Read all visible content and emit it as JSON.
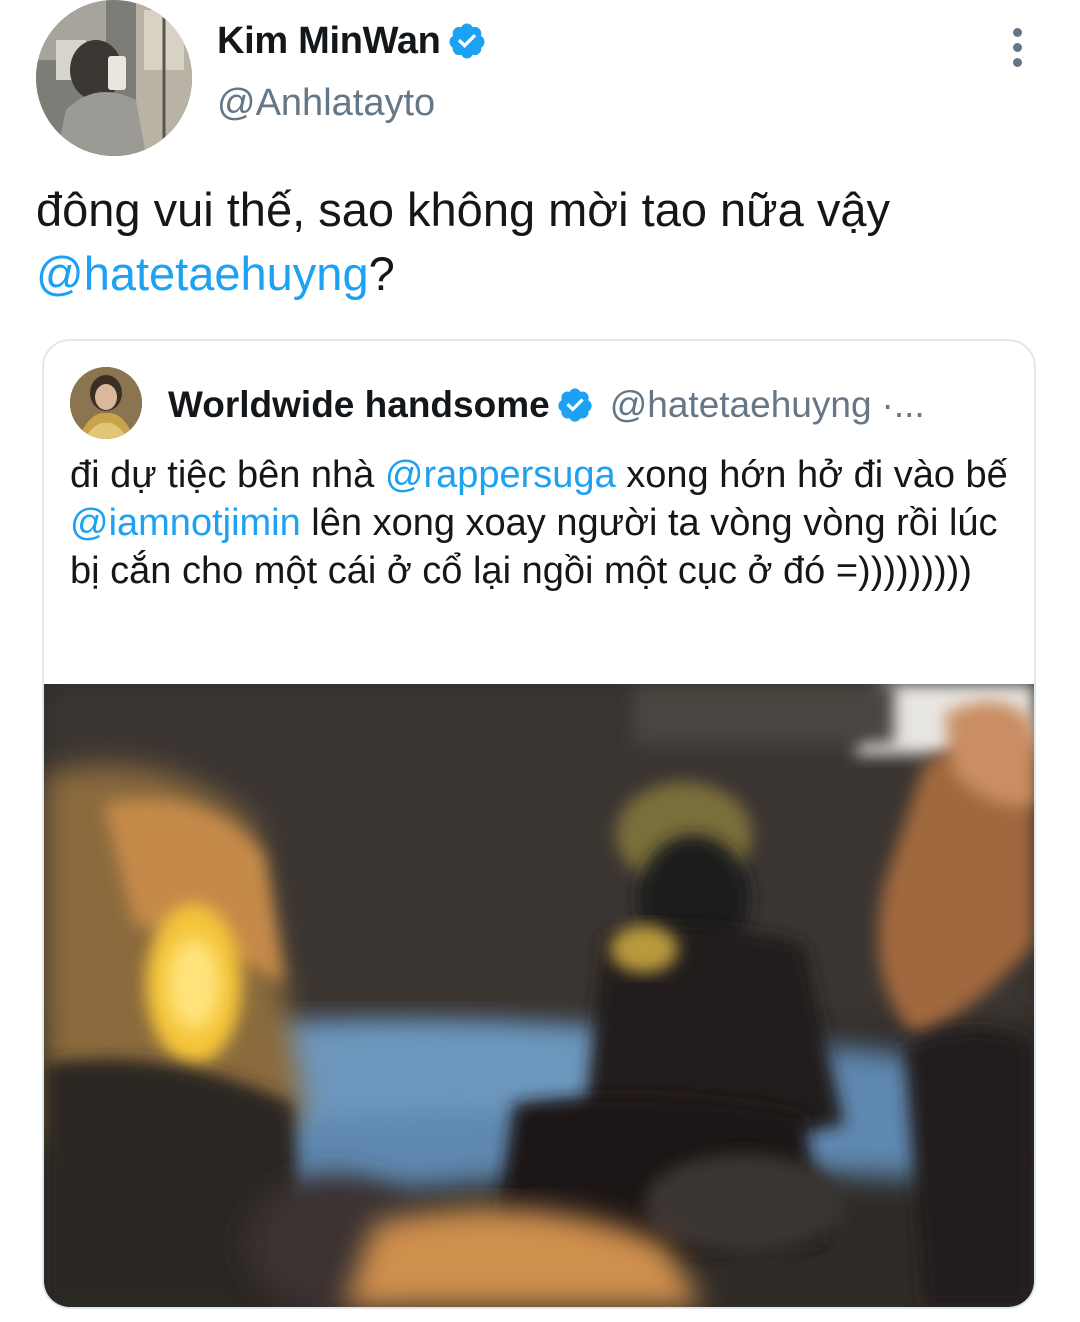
{
  "tweet": {
    "author": {
      "display_name": "Kim MinWan",
      "handle": "@Anhlatayto",
      "verified": true,
      "avatar_icon": "profile-photo"
    },
    "text_parts": {
      "line1": "đông vui thế, sao không mời tao nữa vậy",
      "mention": "@hatetaehuyng",
      "tail": "?"
    },
    "more_icon": "more-vertical-icon"
  },
  "quoted_tweet": {
    "author": {
      "display_name": "Worldwide handsome",
      "handle": "@hatetaehuyng",
      "separator": "·",
      "time_truncated": "...",
      "verified": true
    },
    "text_parts": {
      "p1": "đi dự tiệc bên nhà ",
      "m1": "@rappersuga",
      "p2": " xong hớn hở đi vào bế ",
      "m2": "@iamnotjimin",
      "p3": " lên xong xoay người ta vòng vòng rồi lúc bị cắn cho một cái ở cổ lại ngồi một cục ở đó =)))))))))"
    },
    "media": {
      "type": "photo"
    }
  },
  "colors": {
    "link": "#1da1f2",
    "secondary_text": "#657786",
    "primary_text": "#14171a",
    "border": "#e1e8ed"
  }
}
